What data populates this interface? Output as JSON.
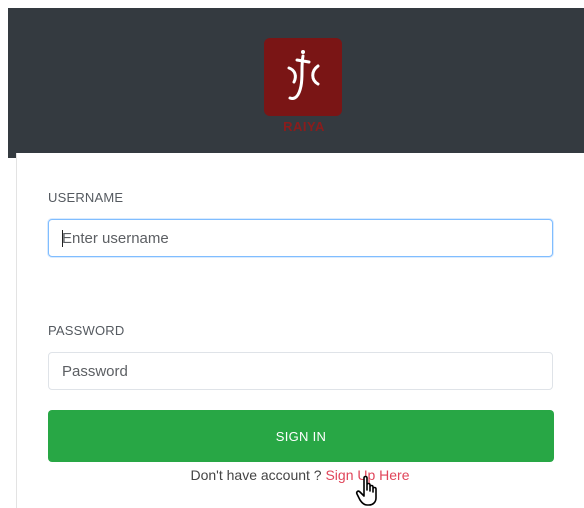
{
  "brand": {
    "logo_text": "RAIYA",
    "logo_color": "#7a1515"
  },
  "form": {
    "username_label": "USERNAME",
    "username_placeholder": "Enter username",
    "username_value": "",
    "password_label": "PASSWORD",
    "password_placeholder": "Password",
    "password_value": ""
  },
  "actions": {
    "sign_in_label": "SIGN IN",
    "signup_prompt": "Don't have account ? ",
    "signup_link": "Sign Up Here"
  },
  "colors": {
    "header_bg": "#343a40",
    "button_bg": "#28a745",
    "link": "#e0455a",
    "focus_border": "#80bdff"
  },
  "icons": {
    "logo": "raiya-logo-icon",
    "cursor": "hand-pointer-icon"
  }
}
